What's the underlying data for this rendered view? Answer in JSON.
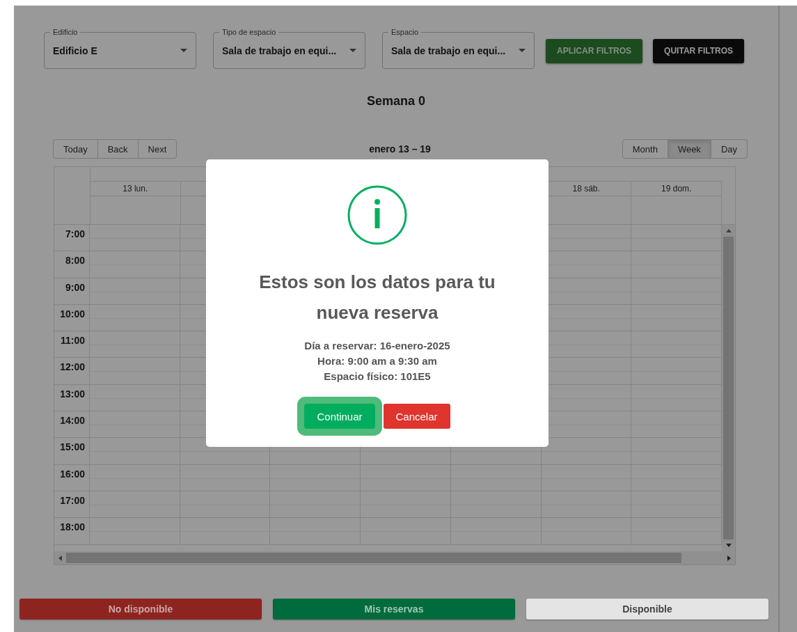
{
  "filters": [
    {
      "label": "Edificio",
      "value": "Edificio E"
    },
    {
      "label": "Tipo de espacio",
      "value": "Sala de trabajo en equi..."
    },
    {
      "label": "Espacio",
      "value": "Sala de trabajo en equi..."
    }
  ],
  "filter_buttons": [
    {
      "label": "APLICAR FILTROS",
      "kind": "apply"
    },
    {
      "label": "QUITAR FILTROS",
      "kind": "clear"
    }
  ],
  "week_title": "Semana 0",
  "calendar": {
    "nav_buttons": [
      "Today",
      "Back",
      "Next"
    ],
    "range": "enero 13 – 19",
    "views": [
      {
        "label": "Month",
        "selected": false
      },
      {
        "label": "Week",
        "selected": true
      },
      {
        "label": "Day",
        "selected": false
      }
    ],
    "day_columns": [
      {
        "label": "13 lun."
      },
      {},
      {},
      {},
      {},
      {
        "label": "18 sáb."
      },
      {
        "label": "19 dom."
      }
    ],
    "times": [
      "7:00",
      "8:00",
      "9:00",
      "10:00",
      "11:00",
      "12:00",
      "13:00",
      "14:00",
      "15:00",
      "16:00",
      "17:00",
      "18:00"
    ]
  },
  "legend": [
    {
      "label": "No disponible",
      "color": "#8e2420"
    },
    {
      "label": "Mis reservas",
      "color": "#006b3c"
    },
    {
      "label": "Disponible",
      "color": "#e4e4e4"
    }
  ],
  "dialog": {
    "title": "Estos son los datos para tu nueva reserva",
    "details": [
      "Día a reservar: 16-enero-2025",
      "Hora: 9:00 am a 9:30 am",
      "Espacio físico: 101E5"
    ],
    "buttons": [
      {
        "label": "Continuar",
        "kind": "confirm",
        "focused": true
      },
      {
        "label": "Cancelar",
        "kind": "cancel",
        "focused": false
      }
    ]
  }
}
